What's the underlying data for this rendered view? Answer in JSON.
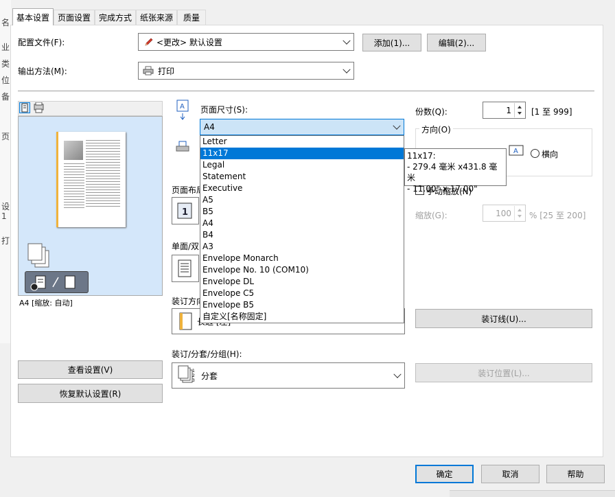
{
  "tabs": [
    "基本设置",
    "页面设置",
    "完成方式",
    "纸张来源",
    "质量"
  ],
  "profile": {
    "label": "配置文件(F):",
    "value": "<更改> 默认设置",
    "add": "添加(1)...",
    "edit": "编辑(2)..."
  },
  "output": {
    "label": "输出方法(M):",
    "value": "打印"
  },
  "preview": {
    "status": "A4 [缩放: 自动]"
  },
  "left_buttons": {
    "view": "查看设置(V)",
    "restore": "恢复默认设置(R)"
  },
  "page_size": {
    "label": "页面尺寸(S):",
    "value": "A4",
    "options": [
      "Letter",
      "11x17",
      "Legal",
      "Statement",
      "Executive",
      "A5",
      "B5",
      "A4",
      "B4",
      "A3",
      "Envelope Monarch",
      "Envelope No. 10 (COM10)",
      "Envelope DL",
      "Envelope C5",
      "Envelope B5",
      "自定义[名称固定]"
    ],
    "selected_index": 1
  },
  "tooltip": {
    "line1": "11x17:",
    "line2": "- 279.4 毫米 x431.8 毫米",
    "line3": "- 11.00\" x 17.00\""
  },
  "labels": {
    "layout": "页面布局",
    "duplex": "单面/双",
    "binding": "装订方向",
    "binding_value": "长边 [左]",
    "finish": "装订/分套/分组(H):",
    "finish_value": "分套"
  },
  "copies": {
    "label": "份数(Q):",
    "value": "1",
    "range": "[1 至 999]"
  },
  "orientation": {
    "label": "方向(O)",
    "landscape": "横向"
  },
  "scaling": {
    "manual": "手动缩放(N)",
    "label": "缩放(G):",
    "value": "100",
    "range": "% [25 至 200]"
  },
  "right_buttons": {
    "gutter": "装订线(U)...",
    "position": "装订位置(L)..."
  },
  "footer": {
    "ok": "确定",
    "cancel": "取消",
    "help": "帮助"
  },
  "bg_fragments": [
    "名",
    "业",
    "类",
    "位",
    "备",
    "页",
    "设",
    "1",
    "打"
  ]
}
